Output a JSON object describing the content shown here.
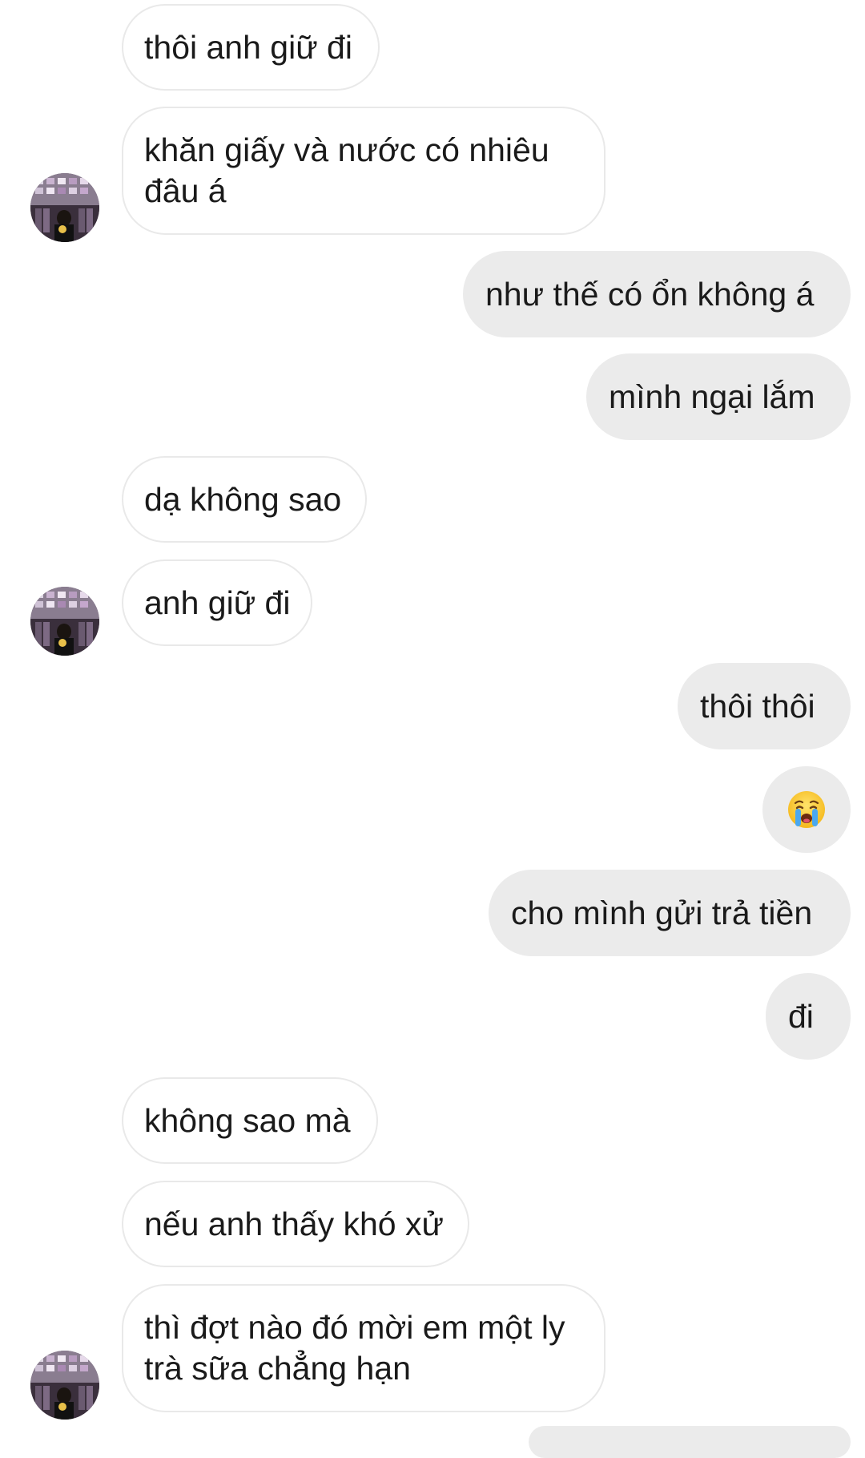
{
  "conversation": {
    "messages": [
      {
        "text": "thôi anh giữ đi",
        "sender": "them"
      },
      {
        "text": "khăn giấy và nước có nhiêu đâu á",
        "sender": "them"
      },
      {
        "text": "như thế có ổn không á",
        "sender": "me"
      },
      {
        "text": "mình ngại lắm",
        "sender": "me"
      },
      {
        "text": "dạ không sao",
        "sender": "them"
      },
      {
        "text": "anh giữ đi",
        "sender": "them"
      },
      {
        "text": "thôi thôi",
        "sender": "me"
      },
      {
        "icon": "crying-face-icon",
        "sender": "me"
      },
      {
        "text": "cho mình gửi trả tiền",
        "sender": "me"
      },
      {
        "text": "đi",
        "sender": "me"
      },
      {
        "text": "không sao mà",
        "sender": "them"
      },
      {
        "text": "nếu anh thấy khó xử",
        "sender": "them"
      },
      {
        "text": "thì đợt nào đó mời em một ly trà sữa chẳng hạn",
        "sender": "them"
      }
    ]
  },
  "avatar": {
    "icon": "contact-avatar"
  },
  "colors": {
    "incoming_bubble_bg": "#ffffff",
    "incoming_bubble_border": "#e9e9e9",
    "outgoing_bubble_bg": "#ebebeb",
    "text": "#1a1a1a"
  }
}
